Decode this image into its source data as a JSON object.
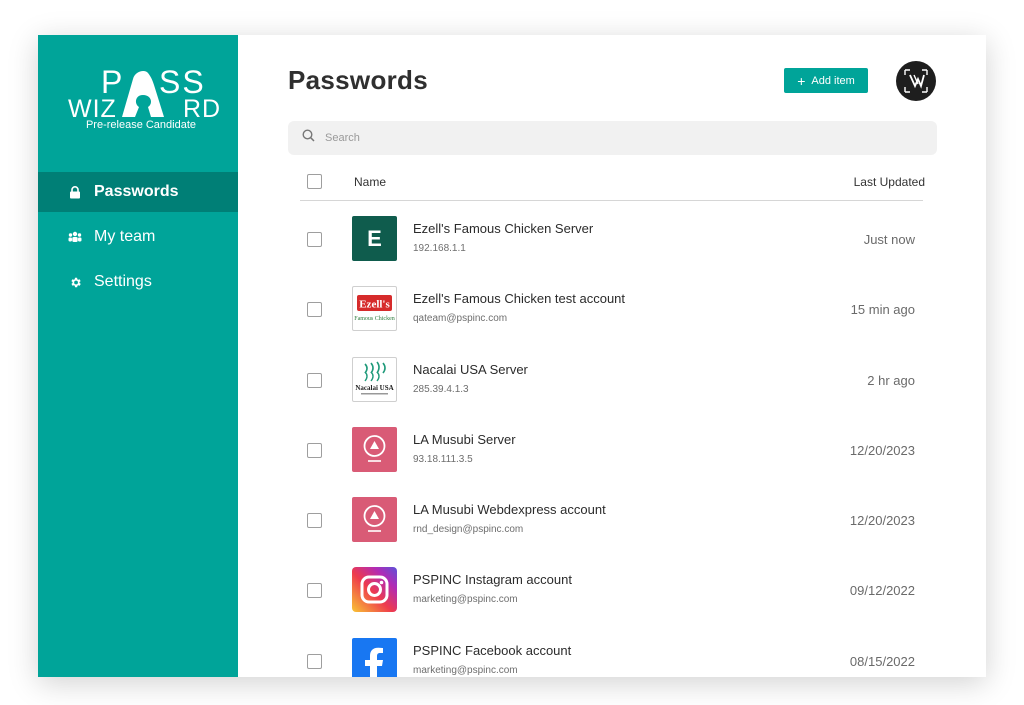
{
  "brand": {
    "logo_top": "PASS",
    "logo_bottom": "WIZARD",
    "subtitle": "Pre-release Candidate",
    "accent": "#00a499",
    "accent_dark": "#007f76"
  },
  "sidebar": {
    "items": [
      {
        "label": "Passwords",
        "icon": "lock-icon",
        "active": true
      },
      {
        "label": "My team",
        "icon": "team-icon",
        "active": false
      },
      {
        "label": "Settings",
        "icon": "gear-icon",
        "active": false
      }
    ]
  },
  "header": {
    "title": "Passwords",
    "add_button_label": "Add item"
  },
  "search": {
    "placeholder": "Search",
    "value": ""
  },
  "table": {
    "columns": {
      "name": "Name",
      "updated": "Last Updated"
    },
    "rows": [
      {
        "title": "Ezell's Famous Chicken Server",
        "sub": "192.168.1.1",
        "time": "Just now",
        "thumb": "letter",
        "thumb_text": "E"
      },
      {
        "title": "Ezell's Famous Chicken test account",
        "sub": "qateam@pspinc.com",
        "time": "15 min ago",
        "thumb": "ezells",
        "thumb_text": "Ezell's",
        "thumb_caption": "Famous Chicken"
      },
      {
        "title": "Nacalai USA Server",
        "sub": "285.39.4.1.3",
        "time": "2 hr ago",
        "thumb": "nacalai",
        "thumb_text": "Nacalai USA"
      },
      {
        "title": "LA Musubi Server",
        "sub": "93.18.111.3.5",
        "time": "12/20/2023",
        "thumb": "musubi"
      },
      {
        "title": "LA Musubi Webdexpress account",
        "sub": "rnd_design@pspinc.com",
        "time": "12/20/2023",
        "thumb": "musubi"
      },
      {
        "title": "PSPINC Instagram account",
        "sub": "marketing@pspinc.com",
        "time": "09/12/2022",
        "thumb": "instagram"
      },
      {
        "title": "PSPINC Facebook account",
        "sub": "marketing@pspinc.com",
        "time": "08/15/2022",
        "thumb": "facebook",
        "thumb_text": "f"
      }
    ]
  }
}
